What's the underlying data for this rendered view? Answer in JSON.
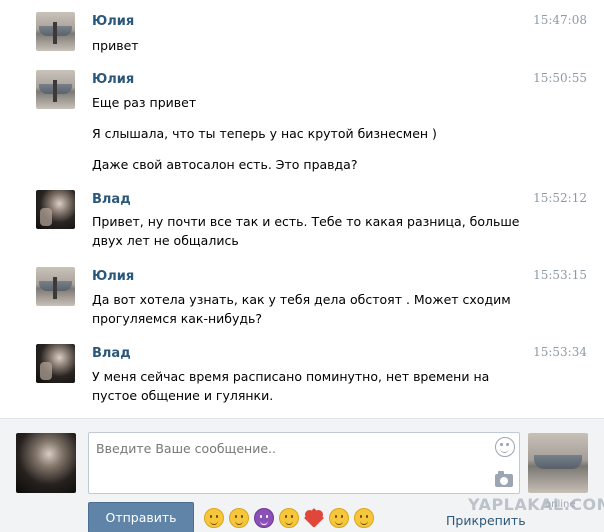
{
  "messages": [
    {
      "author": "Юлия",
      "time": "15:47:08",
      "lines": [
        "привет"
      ]
    },
    {
      "author": "Юлия",
      "time": "15:50:55",
      "lines": [
        "Еще раз привет",
        "Я слышала, что ты теперь у нас крутой бизнесмен )",
        "Даже свой автосалон есть. Это правда?"
      ]
    },
    {
      "author": "Влад",
      "time": "15:52:12",
      "lines": [
        "Привет, ну почти все так и есть. Тебе то какая разница, больше двух лет не общались"
      ]
    },
    {
      "author": "Юлия",
      "time": "15:53:15",
      "lines": [
        "Да вот хотела узнать, как у тебя дела обстоят . Может сходим прогуляемся как-нибудь?"
      ]
    },
    {
      "author": "Влад",
      "time": "15:53:34",
      "lines": [
        "У меня сейчас время расписано поминутно, нет времени на пустое общение и гулянки."
      ]
    }
  ],
  "composer": {
    "placeholder": "Введите Ваше сообщение..",
    "send_label": "Отправить",
    "attach_label": "Прикрепить",
    "online_label": "online",
    "emojis": [
      "grin-emoji",
      "relieved-emoji",
      "devil-emoji",
      "smile-emoji",
      "heart-emoji",
      "flushed-emoji",
      "kiss-emoji"
    ]
  },
  "watermark": "YAPLAKAL.COM",
  "colors": {
    "author": "#2b587a",
    "time": "#8e9aa6",
    "send_button": "#5f84a8",
    "composer_bg": "#f2f3f5"
  }
}
